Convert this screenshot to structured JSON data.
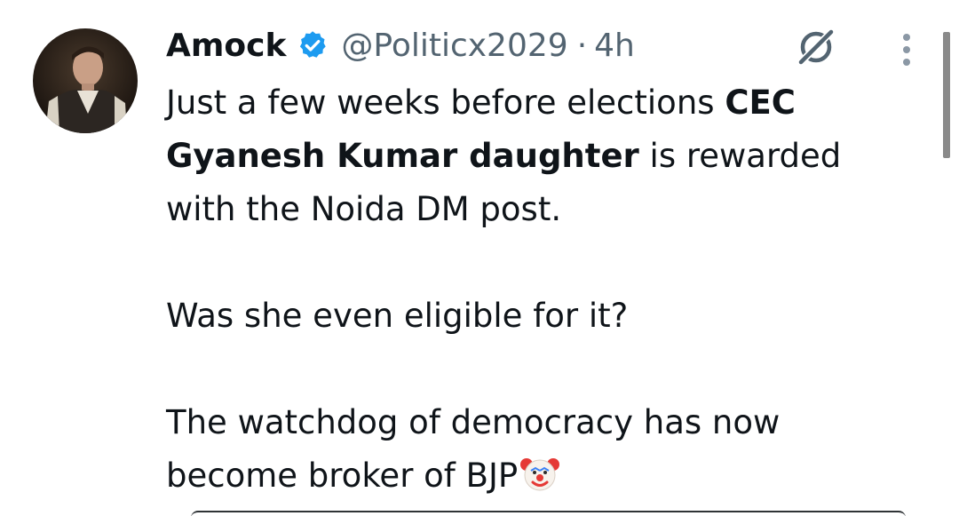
{
  "tweet": {
    "display_name": "Amock",
    "handle": "@Politicx2029",
    "separator": "·",
    "time": "4h",
    "verified_icon": "verified-badge-icon",
    "grok_icon": "grok-icon",
    "more_icon": "more-vertical-icon",
    "text": {
      "line1_prefix": "Just a few weeks  before elections ",
      "line1_bold": "CEC",
      "line2_bold": "Gyanesh Kumar  daughter",
      "line2_suffix": " is rewarded",
      "line3": "with the Noida DM post.",
      "para2": "Was she even eligible for it?",
      "para3_line1": "The watchdog of democracy has now",
      "para3_line2": "become  broker of BJP"
    },
    "emoji": "clown-face"
  },
  "colors": {
    "text": "#0f1419",
    "secondary": "#536471",
    "verified": "#1d9bf0",
    "background": "#ffffff"
  }
}
